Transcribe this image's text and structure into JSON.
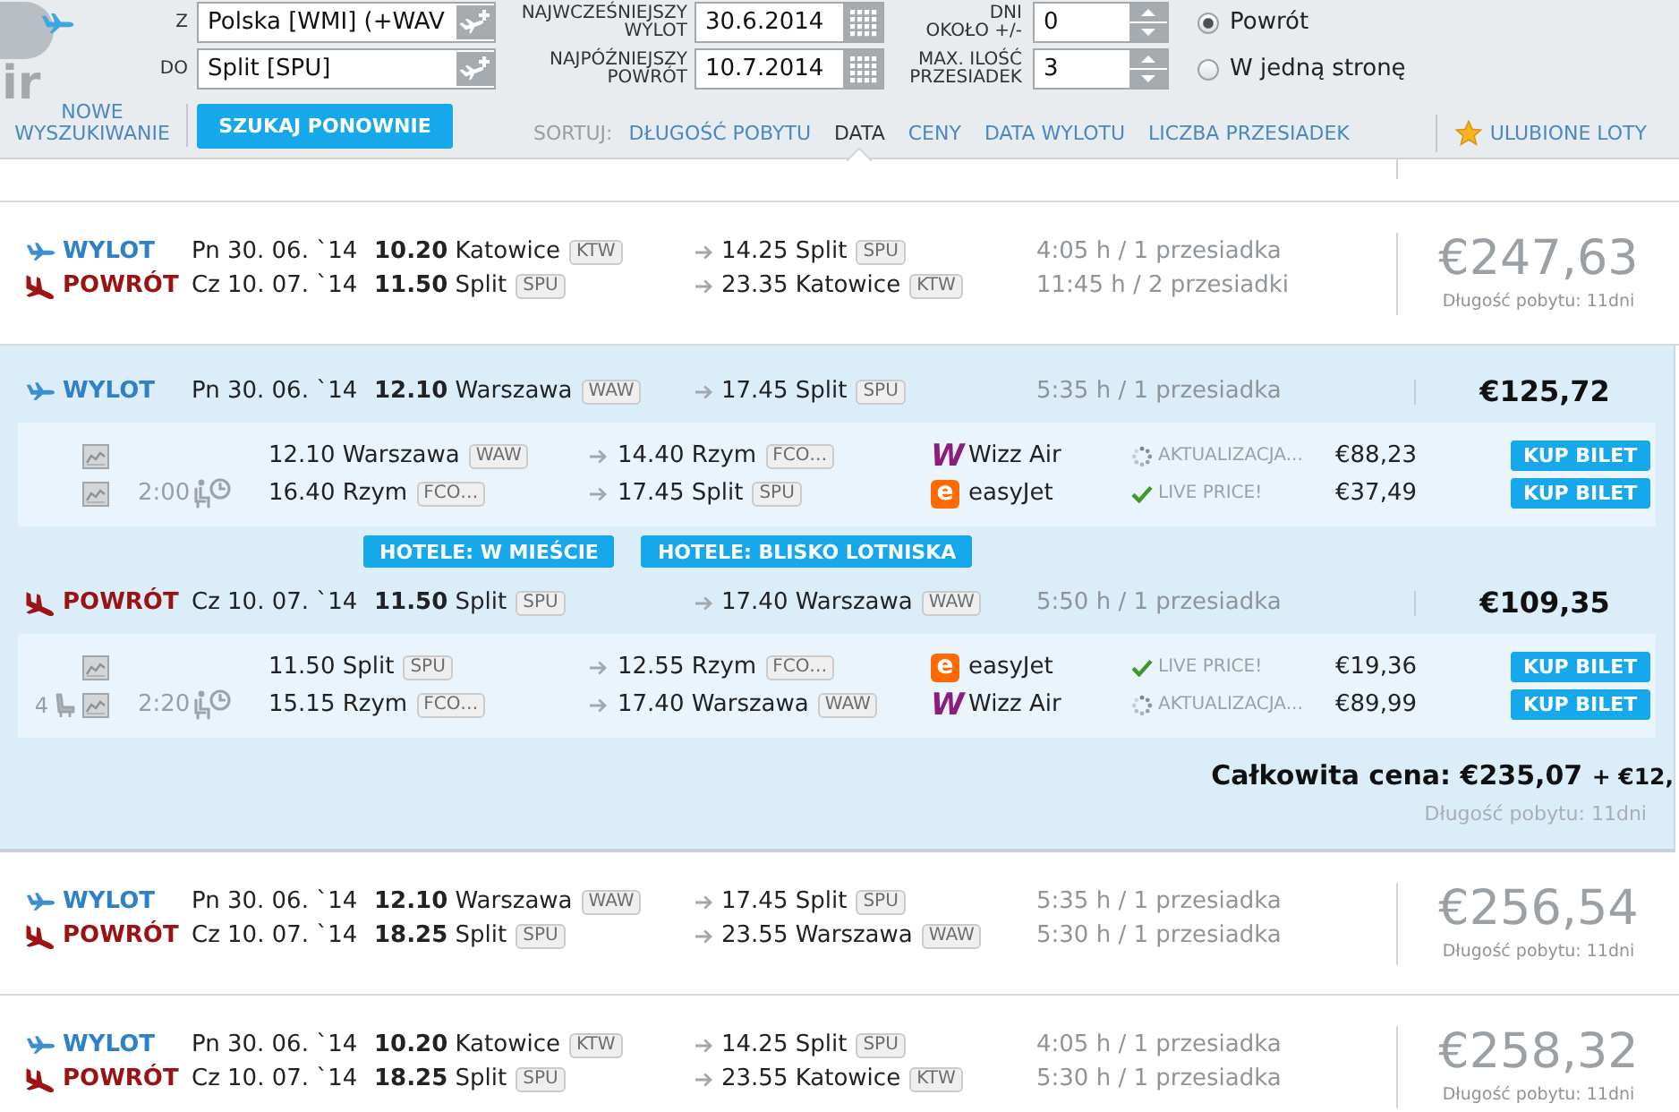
{
  "header": {
    "logo": {
      "text": "ir"
    },
    "from": {
      "label": "Z",
      "value": "Polska [WMI] (+WAV"
    },
    "to": {
      "label": "DO",
      "value": "Split [SPU]"
    },
    "earliest_departure": {
      "label": [
        "NAJWCZEŚNIEJSZY",
        "WYLOT"
      ],
      "value": "30.6.2014"
    },
    "latest_return": {
      "label": [
        "NAJPÓŹNIEJSZY",
        "POWRÓT"
      ],
      "value": "10.7.2014"
    },
    "days_around": {
      "label": [
        "DNI",
        "OKOŁO +/-"
      ],
      "value": "0"
    },
    "max_stops": {
      "label": [
        "MAX. ILOŚĆ",
        "PRZESIADEK"
      ],
      "value": "3"
    },
    "trip_type": [
      {
        "label": "Powrót",
        "selected": true
      },
      {
        "label": "W jedną stronę",
        "selected": false
      }
    ],
    "new_search": "NOWE WYSZUKIWANIE",
    "search_again": "SZUKAJ PONOWNIE",
    "sort_label": "SORTUJ:",
    "sort_options": [
      {
        "label": "DŁUGOŚĆ POBYTU",
        "selected": false
      },
      {
        "label": "DATA",
        "selected": true
      },
      {
        "label": "CENY",
        "selected": false
      },
      {
        "label": "DATA WYLOTU",
        "selected": false
      },
      {
        "label": "LICZBA PRZESIADEK",
        "selected": false
      }
    ],
    "favorites": "ULUBIONE LOTY"
  },
  "results": [
    {
      "expanded": false,
      "legs": [
        {
          "kind": "outbound",
          "label": "WYLOT",
          "date": "Pn 30. 06. `14",
          "dep_time": "10.20",
          "dep_city": "Katowice",
          "dep_code": "KTW",
          "arr_time": "14.25",
          "arr_city": "Split",
          "arr_code": "SPU",
          "duration": "4:05 h / 1 przesiadka"
        },
        {
          "kind": "return",
          "label": "POWRÓT",
          "date": "Cz 10. 07. `14",
          "dep_time": "11.50",
          "dep_city": "Split",
          "dep_code": "SPU",
          "arr_time": "23.35",
          "arr_city": "Katowice",
          "arr_code": "KTW",
          "duration": "11:45 h / 2 przesiadki"
        }
      ],
      "price": "€247,63",
      "stay": "Długość pobytu: 11dni"
    },
    {
      "expanded": true,
      "legs": [
        {
          "kind": "outbound",
          "label": "WYLOT",
          "date": "Pn 30. 06. `14",
          "dep_time": "12.10",
          "dep_city": "Warszawa",
          "dep_code": "WAW",
          "arr_time": "17.45",
          "arr_city": "Split",
          "arr_code": "SPU",
          "duration": "5:35 h / 1 przesiadka",
          "price": "€125,72",
          "segments": [
            {
              "dep_time": "12.10",
              "dep_city": "Warszawa",
              "dep_code": "WAW",
              "arr_time": "14.40",
              "arr_city": "Rzym",
              "arr_code": "FCO…",
              "airline": {
                "kind": "wizz",
                "logo": "W",
                "name": "Wizz Air"
              },
              "status": {
                "kind": "updating",
                "text": "AKTUALIZACJA..."
              },
              "price": "€88,23",
              "buy": "KUP BILET"
            },
            {
              "layover": "2:00",
              "dep_time": "16.40",
              "dep_city": "Rzym",
              "dep_code": "FCO…",
              "arr_time": "17.45",
              "arr_city": "Split",
              "arr_code": "SPU",
              "airline": {
                "kind": "easyjet",
                "logo": "e",
                "name": "easyJet"
              },
              "status": {
                "kind": "live",
                "text": "LIVE PRICE!"
              },
              "price": "€37,49",
              "buy": "KUP BILET"
            }
          ]
        },
        {
          "kind": "return",
          "label": "POWRÓT",
          "date": "Cz 10. 07. `14",
          "dep_time": "11.50",
          "dep_city": "Split",
          "dep_code": "SPU",
          "arr_time": "17.40",
          "arr_city": "Warszawa",
          "arr_code": "WAW",
          "duration": "5:50 h / 1 przesiadka",
          "price": "€109,35",
          "segments": [
            {
              "dep_time": "11.50",
              "dep_city": "Split",
              "dep_code": "SPU",
              "arr_time": "12.55",
              "arr_city": "Rzym",
              "arr_code": "FCO…",
              "airline": {
                "kind": "easyjet",
                "logo": "e",
                "name": "easyJet"
              },
              "status": {
                "kind": "live",
                "text": "LIVE PRICE!"
              },
              "price": "€19,36",
              "buy": "KUP BILET"
            },
            {
              "seats": "4",
              "layover": "2:20",
              "dep_time": "15.15",
              "dep_city": "Rzym",
              "dep_code": "FCO…",
              "arr_time": "17.40",
              "arr_city": "Warszawa",
              "arr_code": "WAW",
              "airline": {
                "kind": "wizz",
                "logo": "W",
                "name": "Wizz Air"
              },
              "status": {
                "kind": "updating",
                "text": "AKTUALIZACJA..."
              },
              "price": "€89,99",
              "buy": "KUP BILET"
            }
          ]
        }
      ],
      "hotels": [
        "HOTELE: W MIEŚCIE",
        "HOTELE: BLISKO LOTNISKA"
      ],
      "total": {
        "amount": "Całkowita cena: €235,07",
        "extra": "+ €12,"
      },
      "stay": "Długość pobytu: 11dni"
    },
    {
      "expanded": false,
      "legs": [
        {
          "kind": "outbound",
          "label": "WYLOT",
          "date": "Pn 30. 06. `14",
          "dep_time": "12.10",
          "dep_city": "Warszawa",
          "dep_code": "WAW",
          "arr_time": "17.45",
          "arr_city": "Split",
          "arr_code": "SPU",
          "duration": "5:35 h / 1 przesiadka"
        },
        {
          "kind": "return",
          "label": "POWRÓT",
          "date": "Cz 10. 07. `14",
          "dep_time": "18.25",
          "dep_city": "Split",
          "dep_code": "SPU",
          "arr_time": "23.55",
          "arr_city": "Warszawa",
          "arr_code": "WAW",
          "duration": "5:30 h / 1 przesiadka"
        }
      ],
      "price": "€256,54",
      "stay": "Długość pobytu: 11dni"
    },
    {
      "expanded": false,
      "legs": [
        {
          "kind": "outbound",
          "label": "WYLOT",
          "date": "Pn 30. 06. `14",
          "dep_time": "10.20",
          "dep_city": "Katowice",
          "dep_code": "KTW",
          "arr_time": "14.25",
          "arr_city": "Split",
          "arr_code": "SPU",
          "duration": "4:05 h / 1 przesiadka"
        },
        {
          "kind": "return",
          "label": "POWRÓT",
          "date": "Cz 10. 07. `14",
          "dep_time": "18.25",
          "dep_city": "Split",
          "dep_code": "SPU",
          "arr_time": "23.55",
          "arr_city": "Katowice",
          "arr_code": "KTW",
          "duration": "5:30 h / 1 przesiadka"
        }
      ],
      "price": "€258,32",
      "stay": "Długość pobytu: 11dni"
    }
  ]
}
